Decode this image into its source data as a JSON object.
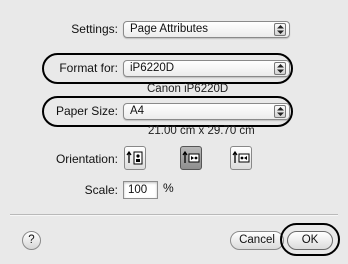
{
  "settings": {
    "label": "Settings:",
    "value": "Page Attributes"
  },
  "format_for": {
    "label": "Format for:",
    "value": "iP6220D",
    "printer_name": "Canon iP6220D"
  },
  "paper_size": {
    "label": "Paper Size:",
    "value": "A4",
    "dimensions": "21.00 cm x 29.70 cm"
  },
  "orientation": {
    "label": "Orientation:",
    "options": [
      {
        "icon": "portrait-orientation-icon",
        "selected": false
      },
      {
        "icon": "landscape-left-orientation-icon",
        "selected": true
      },
      {
        "icon": "landscape-right-orientation-icon",
        "selected": false
      }
    ]
  },
  "scale": {
    "label": "Scale:",
    "value": "100",
    "unit": "%"
  },
  "footer": {
    "help": "?",
    "cancel": "Cancel",
    "ok": "OK"
  },
  "colors": {
    "highlight_ring": "#000000",
    "background": "#e9e9e9"
  }
}
